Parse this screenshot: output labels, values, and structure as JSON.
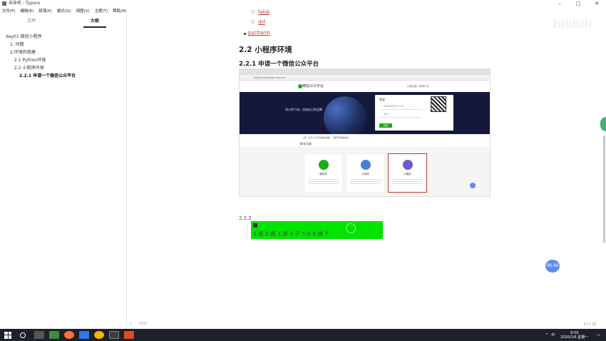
{
  "window": {
    "title": "未命名 - Typora",
    "minimize": "–",
    "maximize": "□",
    "close": "✕"
  },
  "menu": [
    "文件(F)",
    "编辑(E)",
    "段落(P)",
    "格式(O)",
    "视图(V)",
    "主题(T)",
    "帮助(H)"
  ],
  "sidebar": {
    "tabs": [
      "文件",
      "大纲"
    ],
    "active_tab": "大纲",
    "outline": [
      {
        "label": "day01 微信小程序",
        "level": 1
      },
      {
        "label": "1. 问题",
        "level": 2
      },
      {
        "label": "2.环境的搭建",
        "level": 2
      },
      {
        "label": "2.1 Python环境",
        "level": 3
      },
      {
        "label": "2.2 小程序环境",
        "level": 3
      },
      {
        "label": "2.2.1 申请一个微信公众平台",
        "level": 4
      }
    ],
    "footer_back": "‹",
    "footer_code": "</>"
  },
  "doc": {
    "sub_items": [
      "falsk",
      "drf"
    ],
    "list_item": "pycharm",
    "h2": "2.2 小程序环境",
    "h3": "2.2.1 申请一个微信公众平台",
    "section_num": "2.2.2",
    "green_text": "1.吧 2.把 3.并 4.子 5.U 6.锁 7."
  },
  "screenshot": {
    "address": "https://mp.weixin.qq.com",
    "brand": "微信公众平台",
    "header_links": "立即注册 | 简体中文",
    "banner_text": "再小的个体，也有自己的品牌",
    "login_title": "登录",
    "login_user": "邮箱/微信号/QQ号",
    "login_pass": "密码",
    "login_button": "登录",
    "notice": "公告 · 关于公众号注册的通知 · 小程序开发新能力",
    "account_title": "帐号分类",
    "cards": [
      {
        "name": "服务号",
        "color": "#1aad19"
      },
      {
        "name": "订阅号",
        "color": "#4a7fd6"
      },
      {
        "name": "小程序",
        "color": "#6a5acd"
      }
    ]
  },
  "word_count": "217 词",
  "timer": "06:46",
  "watermark": "bilibili",
  "taskbar": {
    "time": "8:59",
    "date": "2020/1/6 星期一",
    "tray_text": "中",
    "apps": [
      "#ff7139",
      "#2b7be4",
      "#f4b400",
      "#3d3d3d",
      "#e64a19"
    ]
  }
}
